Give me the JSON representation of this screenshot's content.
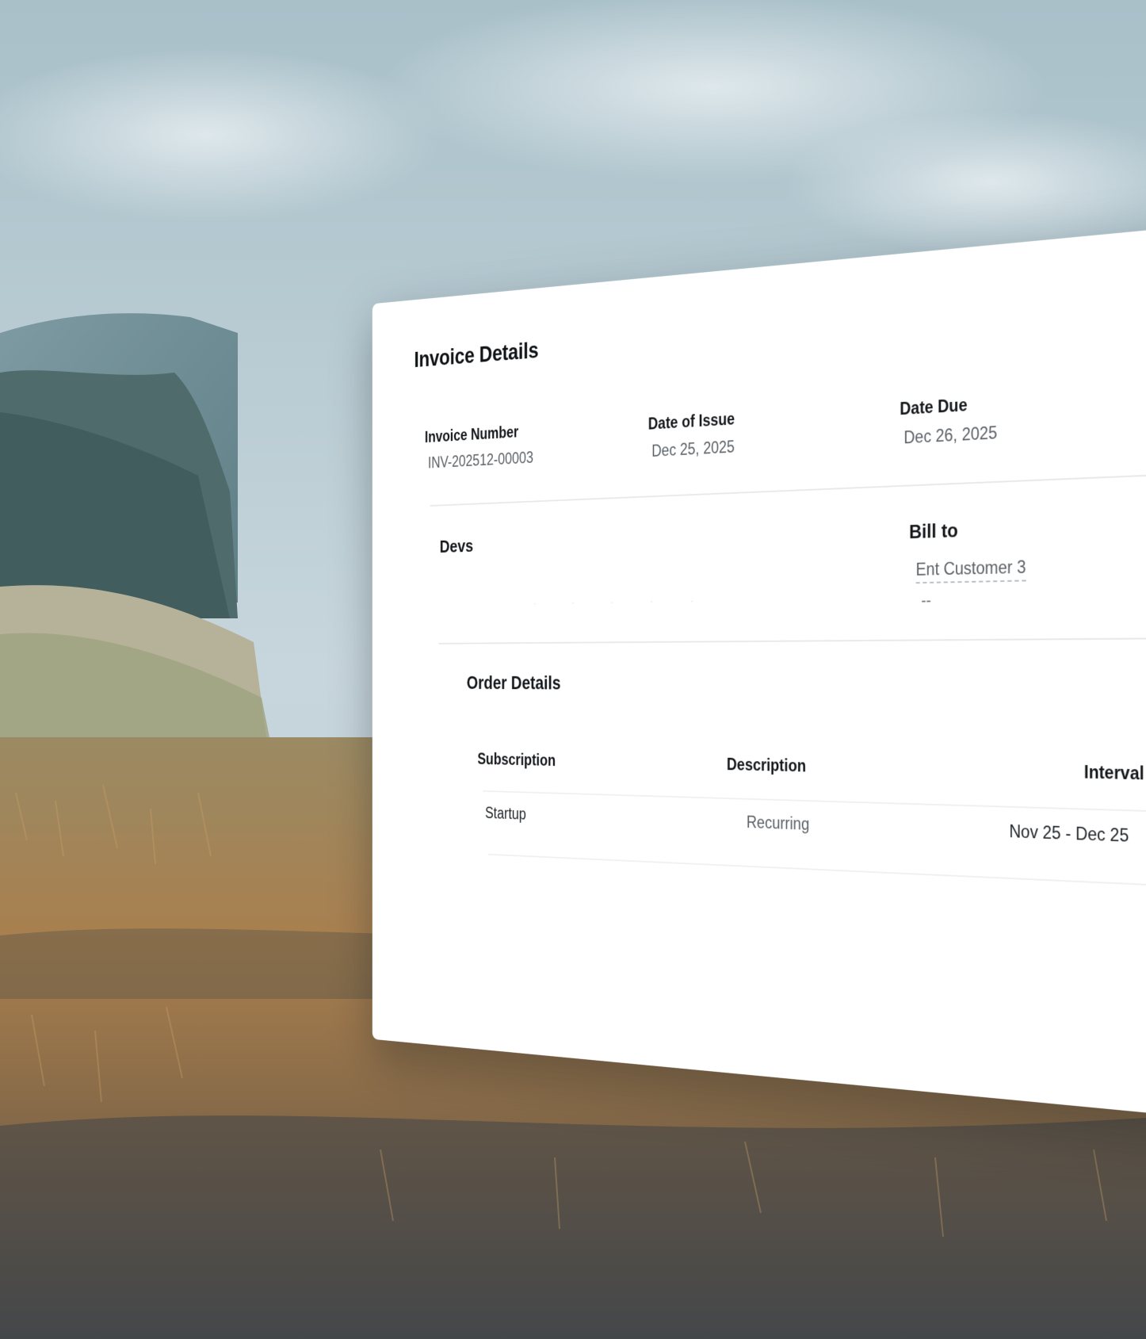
{
  "invoice": {
    "title": "Invoice Details",
    "number_label": "Invoice Number",
    "number_value": "INV-202512-00003",
    "issue_label": "Date of Issue",
    "issue_value": "Dec 25, 2025",
    "due_label": "Date Due",
    "due_value": "Dec 26, 2025"
  },
  "parties": {
    "from_name": "Devs",
    "bill_to_label": "Bill to",
    "bill_to_name": "Ent Customer 3",
    "bill_to_extra": "--"
  },
  "order": {
    "title": "Order Details",
    "columns": [
      "Subscription",
      "Description",
      "Interval"
    ],
    "rows": [
      {
        "subscription": "Startup",
        "description": "Recurring",
        "interval": "Nov 25 - Dec 25"
      }
    ]
  },
  "colors": {
    "card": "#ffffff",
    "heading": "#15181b",
    "muted_text": "#5b6166",
    "divider": "#e6e8ea"
  }
}
